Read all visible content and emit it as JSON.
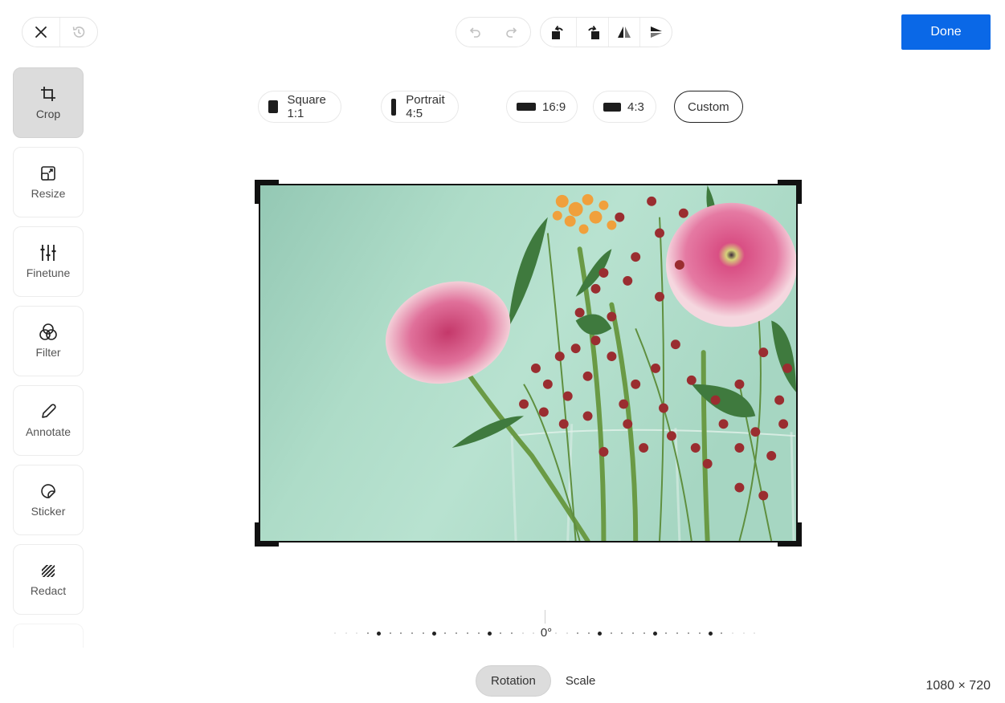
{
  "toolbar": {
    "close_label": "Close",
    "revert_label": "Revert",
    "undo_label": "Undo",
    "redo_label": "Redo",
    "rotate_left_label": "Rotate left",
    "rotate_right_label": "Rotate right",
    "flip_horizontal_label": "Flip horizontal",
    "flip_vertical_label": "Flip vertical",
    "done_label": "Done"
  },
  "sidebar": {
    "items": [
      {
        "label": "Crop",
        "icon": "crop-icon",
        "active": true
      },
      {
        "label": "Resize",
        "icon": "resize-icon"
      },
      {
        "label": "Finetune",
        "icon": "sliders-icon"
      },
      {
        "label": "Filter",
        "icon": "filter-icon"
      },
      {
        "label": "Annotate",
        "icon": "pencil-icon"
      },
      {
        "label": "Sticker",
        "icon": "sticker-icon"
      },
      {
        "label": "Redact",
        "icon": "redact-icon"
      }
    ]
  },
  "aspect_ratios": [
    {
      "label": "Square 1:1",
      "shape": "square"
    },
    {
      "label": "Portrait 4:5",
      "shape": "portrait"
    },
    {
      "label": "16:9",
      "shape": "wide"
    },
    {
      "label": "4:3",
      "shape": "landscape"
    },
    {
      "label": "Custom",
      "shape": "none",
      "selected": true
    }
  ],
  "image": {
    "alt": "Pink gerbera daisies, orange blossoms and red berries in a glass vase against a mint green background"
  },
  "rotation": {
    "angle_label": "0°",
    "angle_value": 0
  },
  "mode_tabs": [
    {
      "label": "Rotation",
      "active": true
    },
    {
      "label": "Scale"
    }
  ],
  "dimensions": "1080 × 720",
  "colors": {
    "accent": "#0a68e7",
    "active_tool_bg": "#dcdcdc",
    "photo_background": "#a8d8c6"
  }
}
